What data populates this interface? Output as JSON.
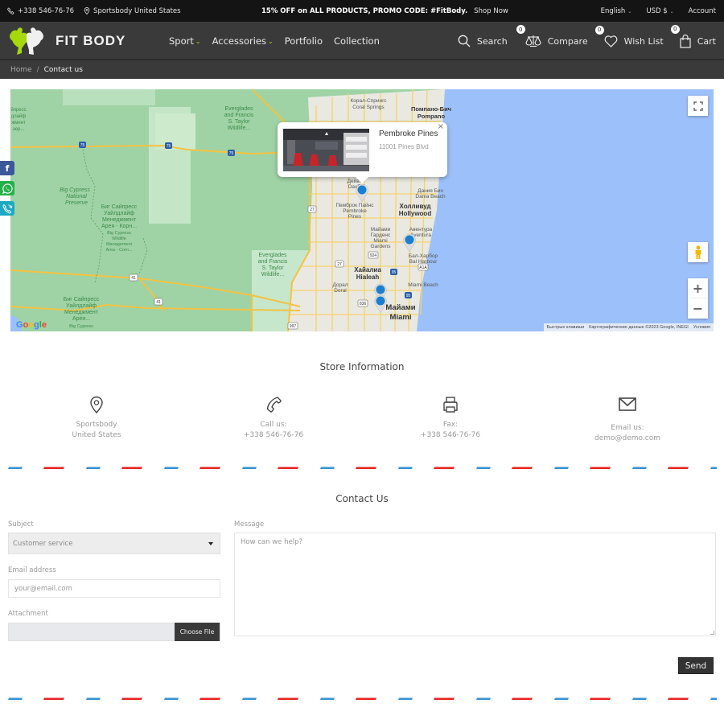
{
  "topbar": {
    "phone": "+338 546-76-76",
    "location": "Sportsbody United States",
    "promo_text": "15% OFF on ALL PRODUCTS, PROMO CODE: #FitBody.",
    "promo_link": "Shop Now",
    "language": "English",
    "currency": "USD $",
    "account": "Account"
  },
  "header": {
    "logo_text": "FIT BODY",
    "logo_accent": "#a6d80a",
    "nav": [
      {
        "label": "Sport",
        "has_dropdown": true
      },
      {
        "label": "Accessories",
        "has_dropdown": true
      },
      {
        "label": "Portfolio",
        "has_dropdown": false
      },
      {
        "label": "Collection",
        "has_dropdown": false
      }
    ],
    "tools": {
      "search": "Search",
      "compare": "Compare",
      "compare_count": "0",
      "wishlist": "Wish List",
      "wishlist_count": "0",
      "cart": "Cart",
      "cart_count": "0"
    }
  },
  "breadcrumb": {
    "home": "Home",
    "separator": "/",
    "current": "Contact us"
  },
  "map": {
    "infowindow": {
      "title": "Pembroke Pines",
      "address": "11001 Pines Blvd",
      "close": "×"
    },
    "labels": {
      "everglades_n": "Everglades and Francis S. Taylor Wildlife...",
      "coral_springs_ru": "Корал-Спрингс",
      "coral_springs": "Coral Springs",
      "pompano_ru": "Помпано-Бич",
      "pompano": "Pompano",
      "davie_ru": "Дейви",
      "davie": "Davie",
      "dania_ru": "Дания Бич",
      "dania": "Dania Beach",
      "pembroke_ru": "Пемброк Пайнс",
      "pembroke": "Pembroke Pines",
      "hollywood_ru": "Холливуд",
      "hollywood": "Hollywood",
      "miami_gardens_ru": "Майами Гарденс",
      "miami_gardens": "Miami Gardens",
      "aventura_ru": "Авентура",
      "aventura": "Aventura",
      "bal_harbour_ru": "Бал-Харбор",
      "bal_harbour": "Bal Harbour",
      "hialeah_ru": "Хайалиа",
      "hialeah": "Hialeah",
      "doral_ru": "Доралl",
      "doral": "Doral",
      "miami_beach": "Miami Beach",
      "miami_ru": "Майами",
      "miami": "Miami",
      "big_cypress": "Big Cypress National Preserve",
      "big_cypress_wma_ru": "Биг Сайпресс Уайлдлайф Менеджмент Арея - Корн...",
      "big_cypress_wma": "Big Cypress Wildlife Management Area - Corn...",
      "everglades_s": "Everglades and Francis S. Taylor Wildlife...",
      "big_cypress_wma2_ru": "Биг Сайпресс Уайлдлайф Менеджмент Арея...",
      "big_cypress_wma2": "Big Cypress"
    },
    "highway_shields": [
      "75",
      "75",
      "75",
      "75",
      "27",
      "27",
      "41",
      "41",
      "924",
      "95",
      "95",
      "836",
      "997",
      "A1A"
    ],
    "attribution": [
      "Быстрые клавиши",
      "Картографические данные ©2023 Google, INEGI",
      "Условия"
    ],
    "google_logo": "Google",
    "zoom_in": "+",
    "zoom_out": "−"
  },
  "social": [
    {
      "name": "facebook",
      "glyph": "f",
      "color": "#3b5998"
    },
    {
      "name": "whatsapp",
      "glyph": "✆",
      "color": "#25b04a"
    },
    {
      "name": "phone",
      "glyph": "☏",
      "color": "#1ea8c4"
    }
  ],
  "store_info": {
    "title": "Store Information",
    "items": [
      {
        "icon": "map-pin-icon",
        "line1": "Sportsbody",
        "line2": "United States"
      },
      {
        "icon": "phone-icon",
        "line1": "Call us:",
        "line2": "+338 546-76-76"
      },
      {
        "icon": "fax-icon",
        "line1": "Fax:",
        "line2": "+338 546-76-76"
      },
      {
        "icon": "envelope-icon",
        "line1": "Email us:",
        "line2": "demo@demo.com"
      }
    ]
  },
  "contact": {
    "title": "Contact Us",
    "subject_label": "Subject",
    "subject_value": "Customer service",
    "email_label": "Email address",
    "email_placeholder": "your@email.com",
    "attachment_label": "Attachment",
    "choose_file": "Choose File",
    "message_label": "Message",
    "message_placeholder": "How can we help?",
    "send": "Send"
  },
  "colors": {
    "airmail_red": "#e8231f",
    "airmail_blue": "#3592d3",
    "header_bg": "#3a3a3a",
    "topbar_bg": "#141414"
  }
}
